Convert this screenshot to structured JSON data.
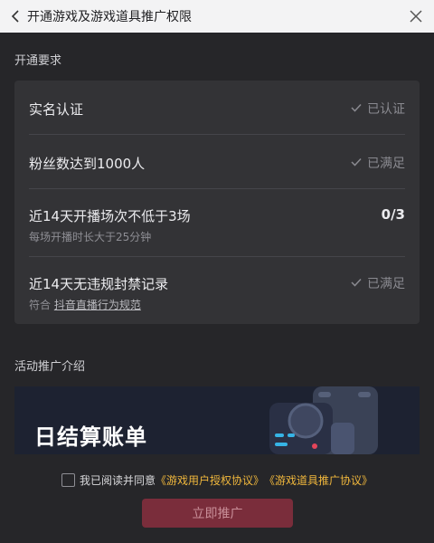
{
  "header": {
    "title": "开通游戏及游戏道具推广权限",
    "back_icon": "chevron-left-icon",
    "close_icon": "close-icon"
  },
  "requirements": {
    "section_label": "开通要求",
    "items": [
      {
        "title": "实名认证",
        "status": "已认证",
        "status_icon": "check-icon"
      },
      {
        "title": "粉丝数达到1000人",
        "status": "已满足",
        "status_icon": "check-icon"
      },
      {
        "title": "近14天开播场次不低于3场",
        "subtitle": "每场开播时长大于25分钟",
        "status": "0/3"
      },
      {
        "title": "近14天无违规封禁记录",
        "subtitle_prefix": "符合 ",
        "subtitle_link": "抖音直播行为规范",
        "status": "已满足",
        "status_icon": "check-icon"
      }
    ]
  },
  "promo": {
    "section_label": "活动推广介绍",
    "banner_title": "日结算账单"
  },
  "agreement": {
    "prefix": "我已阅读并同意",
    "link1": "《游戏用户授权协议》",
    "link2": "《游戏道具推广协议》",
    "checked": false
  },
  "cta": {
    "label": "立即推广"
  },
  "colors": {
    "background": "#262629",
    "card": "#333336",
    "link": "#f0b73c",
    "cta_disabled": "#7a2d3b"
  }
}
